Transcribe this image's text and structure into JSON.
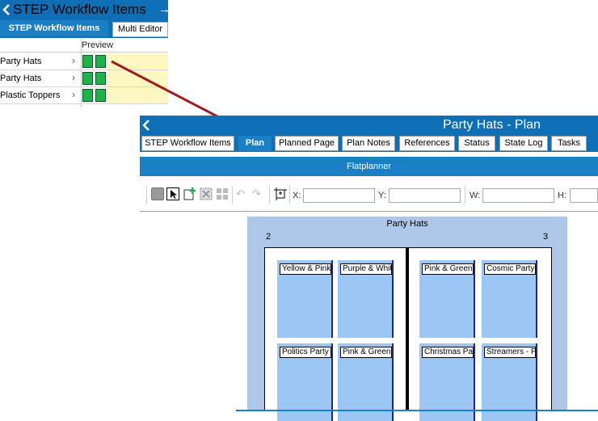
{
  "workflow": {
    "title": "STEP Workflow Items",
    "tabs": {
      "step": "STEP Workflow Items",
      "multi": "Multi Editor"
    },
    "column_preview": "Preview",
    "rows": [
      {
        "label": "Party Hats"
      },
      {
        "label": "Party Hats"
      },
      {
        "label": "Plastic Toppers"
      }
    ]
  },
  "plan": {
    "title": "Party Hats - Plan",
    "tabs": [
      {
        "label": "STEP Workflow Items"
      },
      {
        "label": "Plan"
      },
      {
        "label": "Planned Page"
      },
      {
        "label": "Plan Notes"
      },
      {
        "label": "References"
      },
      {
        "label": "Status"
      },
      {
        "label": "State Log"
      },
      {
        "label": "Tasks"
      }
    ],
    "section_title": "Flatplanner",
    "toolbar": {
      "x": "X:",
      "y": "Y:",
      "w": "W:",
      "h": "H:"
    },
    "canvas": {
      "title": "Party Hats",
      "left_page": "2",
      "right_page": "3",
      "items": [
        {
          "label": "Yellow & Pink"
        },
        {
          "label": "Purple & White"
        },
        {
          "label": "Pink & Green P"
        },
        {
          "label": "Cosmic Party H"
        },
        {
          "label": "Politics Party H"
        },
        {
          "label": "Pink & Green P"
        },
        {
          "label": "Christmas Party"
        },
        {
          "label": "Streamers - Pu"
        }
      ]
    }
  },
  "colors": {
    "header_blue": "#0f6fb6",
    "active_tab": "#1a7fc4",
    "preview_green": "#1db34a",
    "canvas_bg": "#aec7e8",
    "item_fill": "#9cc7f5",
    "arrow": "#a01c1c"
  }
}
